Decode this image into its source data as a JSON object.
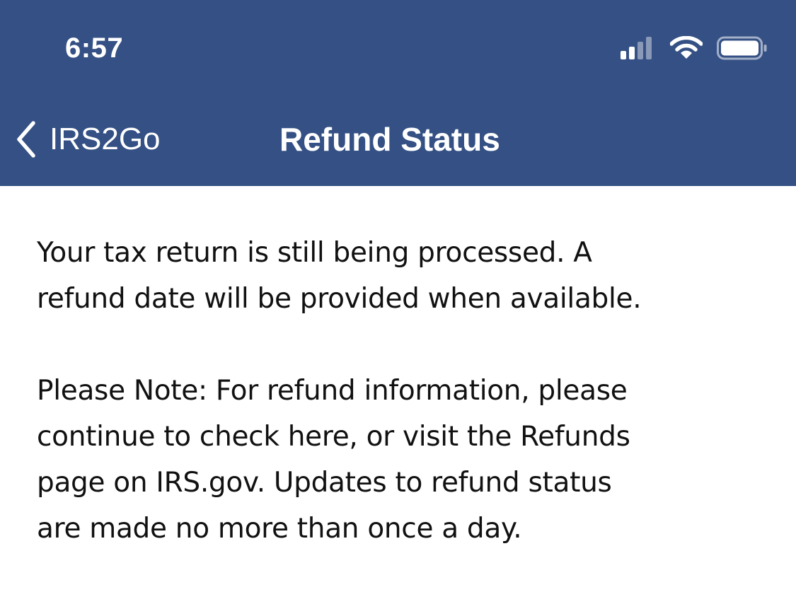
{
  "status_bar": {
    "time": "6:57",
    "icons": [
      "cellular-signal-icon",
      "wifi-icon",
      "battery-icon"
    ]
  },
  "nav": {
    "back_label": "IRS2Go",
    "title": "Refund Status"
  },
  "content": {
    "message": "Your tax return is still being processed.  A\nrefund date will be provided when available.",
    "note": "Please Note: For refund information, please\ncontinue to check here, or visit the Refunds\npage on IRS.gov. Updates to refund status\nare made no more than once a day."
  },
  "colors": {
    "header_background": "#345084",
    "header_text": "#ffffff",
    "body_text": "#111111",
    "background": "#ffffff"
  }
}
